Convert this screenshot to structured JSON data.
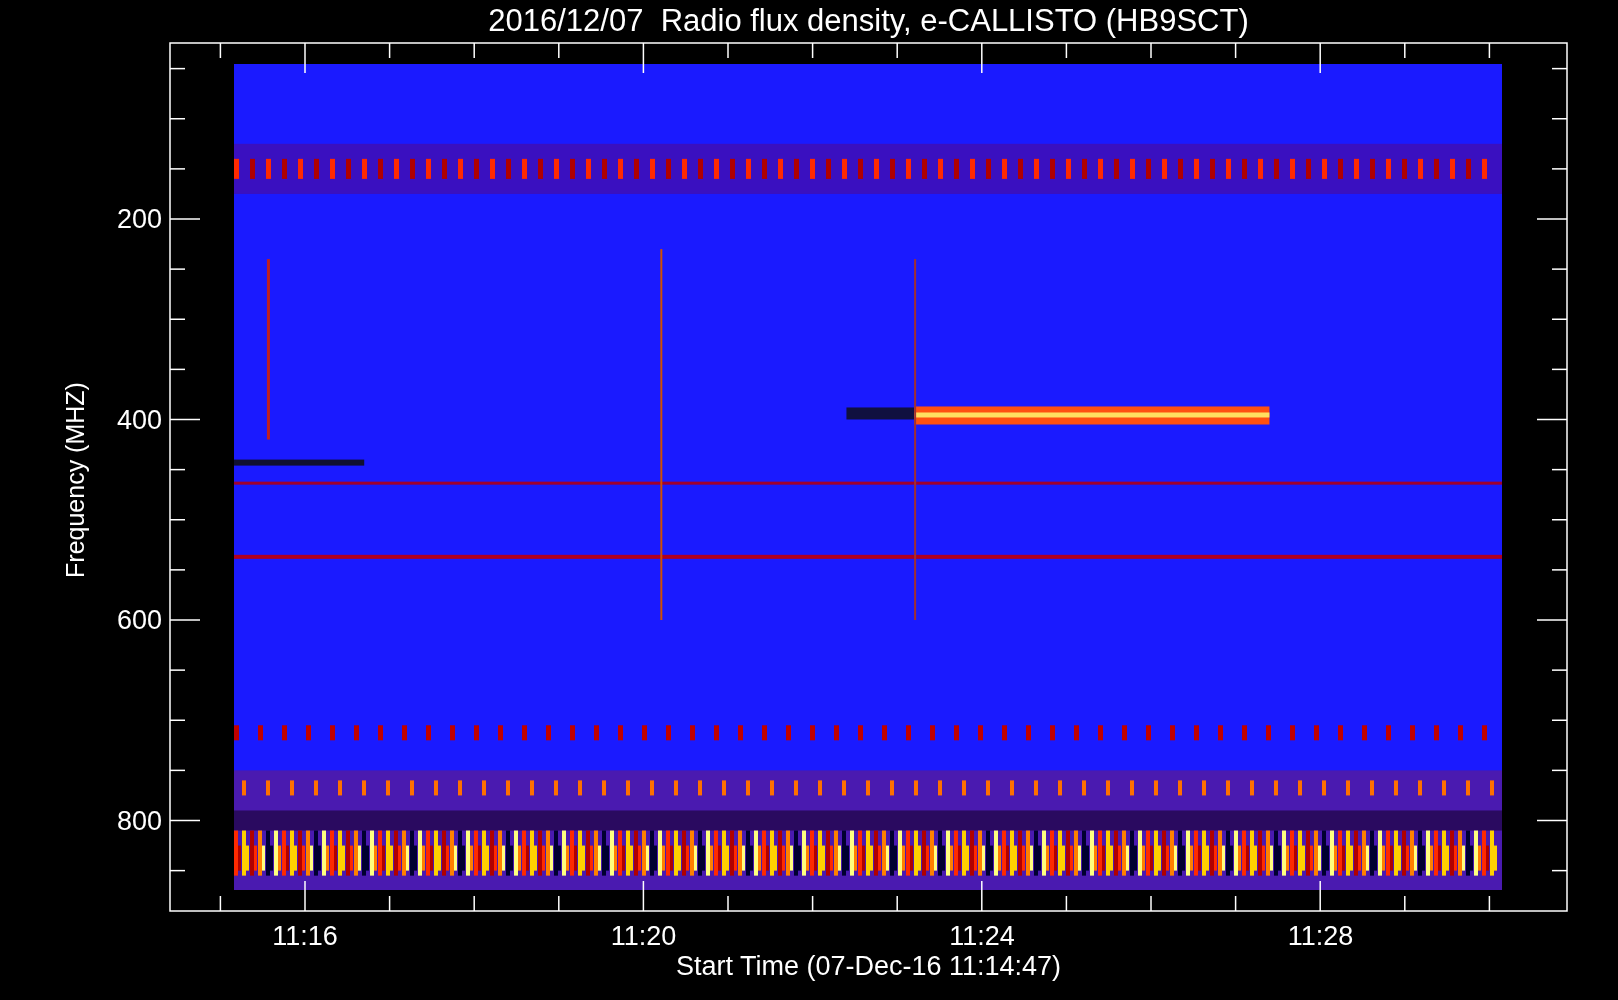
{
  "title": "2016/12/07  Radio flux density, e-CALLISTO (HB9SCT)",
  "y_axis": {
    "label": "Frequency (MHZ)",
    "ticks": [
      "200",
      "400",
      "600",
      "800"
    ]
  },
  "x_axis": {
    "label": "Start Time (07-Dec-16 11:14:47)",
    "ticks": [
      "11:16",
      "11:20",
      "11:24",
      "11:28"
    ]
  }
}
